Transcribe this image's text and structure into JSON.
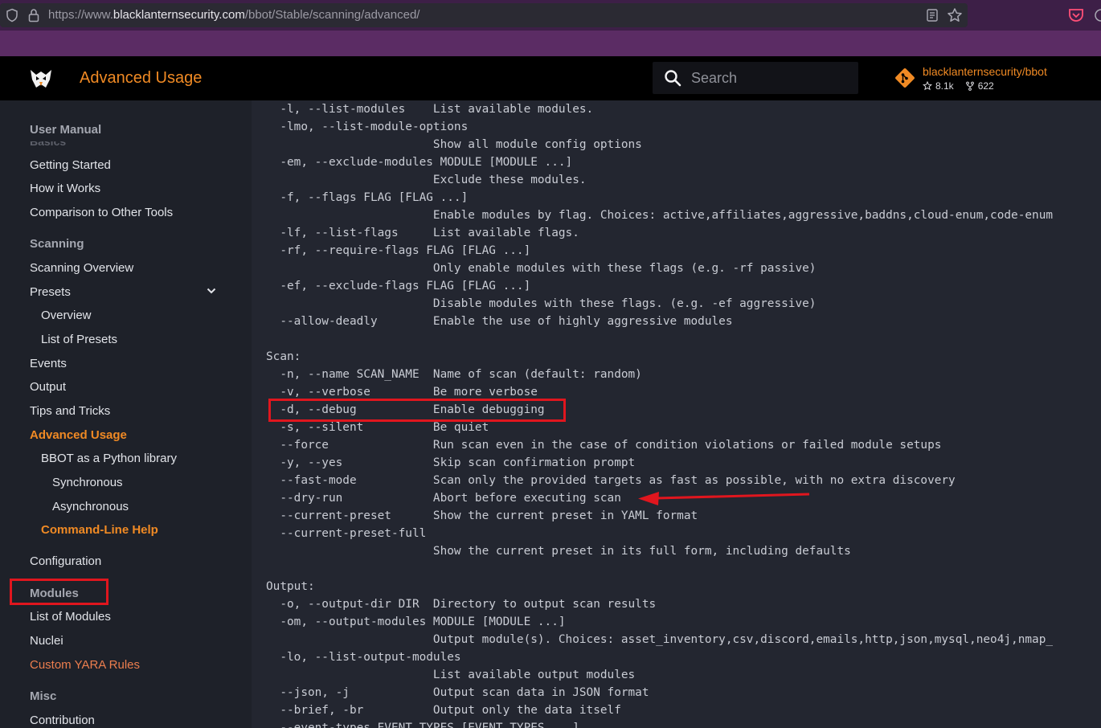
{
  "browser": {
    "url_prefix": "https://www.",
    "url_domain": "blacklanternsecurity.com",
    "url_path": "/bbot/Stable/scanning/advanced/"
  },
  "header": {
    "title": "Advanced Usage",
    "search_placeholder": "Search",
    "repo_name": "blacklanternsecurity/bbot",
    "stars": "8.1k",
    "forks": "622"
  },
  "colors": {
    "accent": "#f08a24",
    "highlight": "#e0161e",
    "browser_band": "#5b2c64"
  },
  "sidebar": {
    "user_manual": "User Manual",
    "basics": "Basics",
    "getting_started": "Getting Started",
    "how_it_works": "How it Works",
    "comparison": "Comparison to Other Tools",
    "scanning": "Scanning",
    "scanning_overview": "Scanning Overview",
    "presets": "Presets",
    "overview": "Overview",
    "list_of_presets": "List of Presets",
    "events": "Events",
    "output": "Output",
    "tips": "Tips and Tricks",
    "advanced_usage": "Advanced Usage",
    "bbot_python": "BBOT as a Python library",
    "synchronous": "Synchronous",
    "asynchronous": "Asynchronous",
    "cli_help": "Command-Line Help",
    "configuration": "Configuration",
    "modules": "Modules",
    "list_of_modules": "List of Modules",
    "nuclei": "Nuclei",
    "custom_yara": "Custom YARA Rules",
    "misc": "Misc",
    "contribution": "Contribution"
  },
  "code_lines": [
    "  -l, --list-modules    List available modules.",
    "  -lmo, --list-module-options",
    "                        Show all module config options",
    "  -em, --exclude-modules MODULE [MODULE ...]",
    "                        Exclude these modules.",
    "  -f, --flags FLAG [FLAG ...]",
    "                        Enable modules by flag. Choices: active,affiliates,aggressive,baddns,cloud-enum,code-enum",
    "  -lf, --list-flags     List available flags.",
    "  -rf, --require-flags FLAG [FLAG ...]",
    "                        Only enable modules with these flags (e.g. -rf passive)",
    "  -ef, --exclude-flags FLAG [FLAG ...]",
    "                        Disable modules with these flags. (e.g. -ef aggressive)",
    "  --allow-deadly        Enable the use of highly aggressive modules",
    "",
    "Scan:",
    "  -n, --name SCAN_NAME  Name of scan (default: random)",
    "  -v, --verbose         Be more verbose",
    "  -d, --debug           Enable debugging",
    "  -s, --silent          Be quiet",
    "  --force               Run scan even in the case of condition violations or failed module setups",
    "  -y, --yes             Skip scan confirmation prompt",
    "  --fast-mode           Scan only the provided targets as fast as possible, with no extra discovery",
    "  --dry-run             Abort before executing scan",
    "  --current-preset      Show the current preset in YAML format",
    "  --current-preset-full",
    "                        Show the current preset in its full form, including defaults",
    "",
    "Output:",
    "  -o, --output-dir DIR  Directory to output scan results",
    "  -om, --output-modules MODULE [MODULE ...]",
    "                        Output module(s). Choices: asset_inventory,csv,discord,emails,http,json,mysql,neo4j,nmap_",
    "  -lo, --list-output-modules",
    "                        List available output modules",
    "  --json, -j            Output scan data in JSON format",
    "  --brief, -br          Output only the data itself",
    "  --event-types EVENT_TYPES [EVENT_TYPES ...]"
  ]
}
